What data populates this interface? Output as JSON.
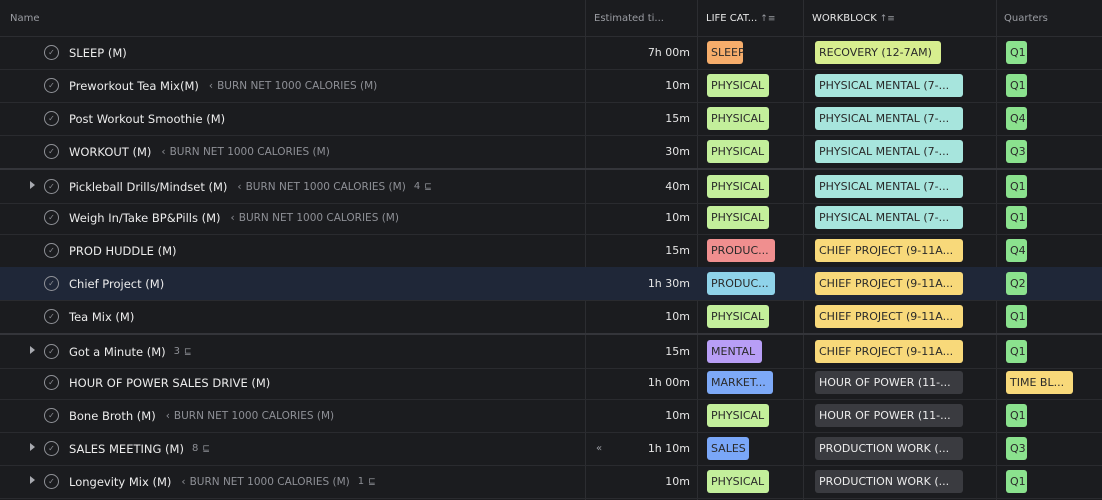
{
  "headers": {
    "name": "Name",
    "estimated": "Estimated ti...",
    "life_category": "LIFE CAT...",
    "life_sort": "↑≡",
    "workblock": "WORKBLOCK",
    "workblock_sort": "↑≡",
    "quarters": "Quarters"
  },
  "colors": {
    "sleep": "#f6ad6b",
    "physical": "#c3ef9b",
    "productivity": "#f08f8f",
    "productivity_alt": "#8fd3ea",
    "mental": "#b89ef6",
    "marketing": "#7da9f7",
    "sales": "#7aa7f8",
    "recovery": "#d7ee8f",
    "physical_mental": "#a7e5dd",
    "chief_project": "#f8d97a",
    "hour_of_power": "#3a3b40",
    "production_work": "#3a3b40",
    "quarter": "#8be28e",
    "time_block": "#f8d97a"
  },
  "rows": [
    {
      "name": "SLEEP (M)",
      "parent": "",
      "subtasks": "",
      "estimate": "7h 00m",
      "life": "SLEEP",
      "life_color": "#f6ad6b",
      "workblock": "RECOVERY (12-7AM)",
      "wb_color": "#d7ee8f",
      "quarter": "Q1"
    },
    {
      "name": "Preworkout Tea Mix(M)",
      "parent": "BURN NET 1000 CALORIES (M)",
      "subtasks": "",
      "estimate": "10m",
      "life": "PHYSICAL",
      "life_color": "#c3ef9b",
      "workblock": "PHYSICAL MENTAL (7-...",
      "wb_color": "#a7e5dd",
      "quarter": "Q1"
    },
    {
      "name": "Post Workout Smoothie (M)",
      "parent": "",
      "subtasks": "",
      "estimate": "15m",
      "life": "PHYSICAL",
      "life_color": "#c3ef9b",
      "workblock": "PHYSICAL MENTAL (7-...",
      "wb_color": "#a7e5dd",
      "quarter": "Q4"
    },
    {
      "name": "WORKOUT (M)",
      "parent": "BURN NET 1000 CALORIES (M)",
      "subtasks": "",
      "estimate": "30m",
      "life": "PHYSICAL",
      "life_color": "#c3ef9b",
      "workblock": "PHYSICAL MENTAL (7-...",
      "wb_color": "#a7e5dd",
      "quarter": "Q3"
    },
    {
      "name": "Pickleball Drills/Mindset (M)",
      "parent": "BURN NET 1000 CALORIES (M)",
      "subtasks": "4",
      "estimate": "40m",
      "life": "PHYSICAL",
      "life_color": "#c3ef9b",
      "workblock": "PHYSICAL MENTAL (7-...",
      "wb_color": "#a7e5dd",
      "quarter": "Q1"
    },
    {
      "name": "Weigh In/Take BP&Pills (M)",
      "parent": "BURN NET 1000 CALORIES (M)",
      "subtasks": "",
      "estimate": "10m",
      "life": "PHYSICAL",
      "life_color": "#c3ef9b",
      "workblock": "PHYSICAL MENTAL (7-...",
      "wb_color": "#a7e5dd",
      "quarter": "Q1"
    },
    {
      "name": "PROD HUDDLE (M)",
      "parent": "",
      "subtasks": "",
      "estimate": "15m",
      "life": "PRODUC...",
      "life_color": "#f08f8f",
      "workblock": "CHIEF PROJECT (9-11A...",
      "wb_color": "#f8d97a",
      "quarter": "Q4"
    },
    {
      "name": "Chief Project (M)",
      "parent": "",
      "subtasks": "",
      "estimate": "1h 30m",
      "life": "PRODUC...",
      "life_color": "#8fd3ea",
      "workblock": "CHIEF PROJECT (9-11A...",
      "wb_color": "#f8d97a",
      "quarter": "Q2"
    },
    {
      "name": "Tea Mix (M)",
      "parent": "",
      "subtasks": "",
      "estimate": "10m",
      "life": "PHYSICAL",
      "life_color": "#c3ef9b",
      "workblock": "CHIEF PROJECT (9-11A...",
      "wb_color": "#f8d97a",
      "quarter": "Q1"
    },
    {
      "name": "Got a Minute (M)",
      "parent": "",
      "subtasks": "3",
      "estimate": "15m",
      "life": "MENTAL",
      "life_color": "#b89ef6",
      "workblock": "CHIEF PROJECT (9-11A...",
      "wb_color": "#f8d97a",
      "quarter": "Q1"
    },
    {
      "name": "HOUR OF POWER SALES DRIVE (M)",
      "parent": "",
      "subtasks": "",
      "estimate": "1h 00m",
      "life": "MARKET...",
      "life_color": "#7da9f7",
      "workblock": "HOUR OF POWER (11-...",
      "wb_color": "#3a3b40",
      "quarter": "TIME BL..."
    },
    {
      "name": "Bone Broth (M)",
      "parent": "BURN NET 1000 CALORIES (M)",
      "subtasks": "",
      "estimate": "10m",
      "life": "PHYSICAL",
      "life_color": "#c3ef9b",
      "workblock": "HOUR OF POWER (11-...",
      "wb_color": "#3a3b40",
      "quarter": "Q1"
    },
    {
      "name": "SALES MEETING (M)",
      "parent": "",
      "subtasks": "8",
      "estimate": "1h 10m",
      "life": "SALES",
      "life_color": "#7aa7f8",
      "workblock": "PRODUCTION WORK (...",
      "wb_color": "#3a3b40",
      "quarter": "Q3"
    },
    {
      "name": "Longevity Mix (M)",
      "parent": "BURN NET 1000 CALORIES (M)",
      "subtasks": "1",
      "estimate": "10m",
      "life": "PHYSICAL",
      "life_color": "#c3ef9b",
      "workblock": "PRODUCTION WORK (...",
      "wb_color": "#3a3b40",
      "quarter": "Q1"
    }
  ]
}
